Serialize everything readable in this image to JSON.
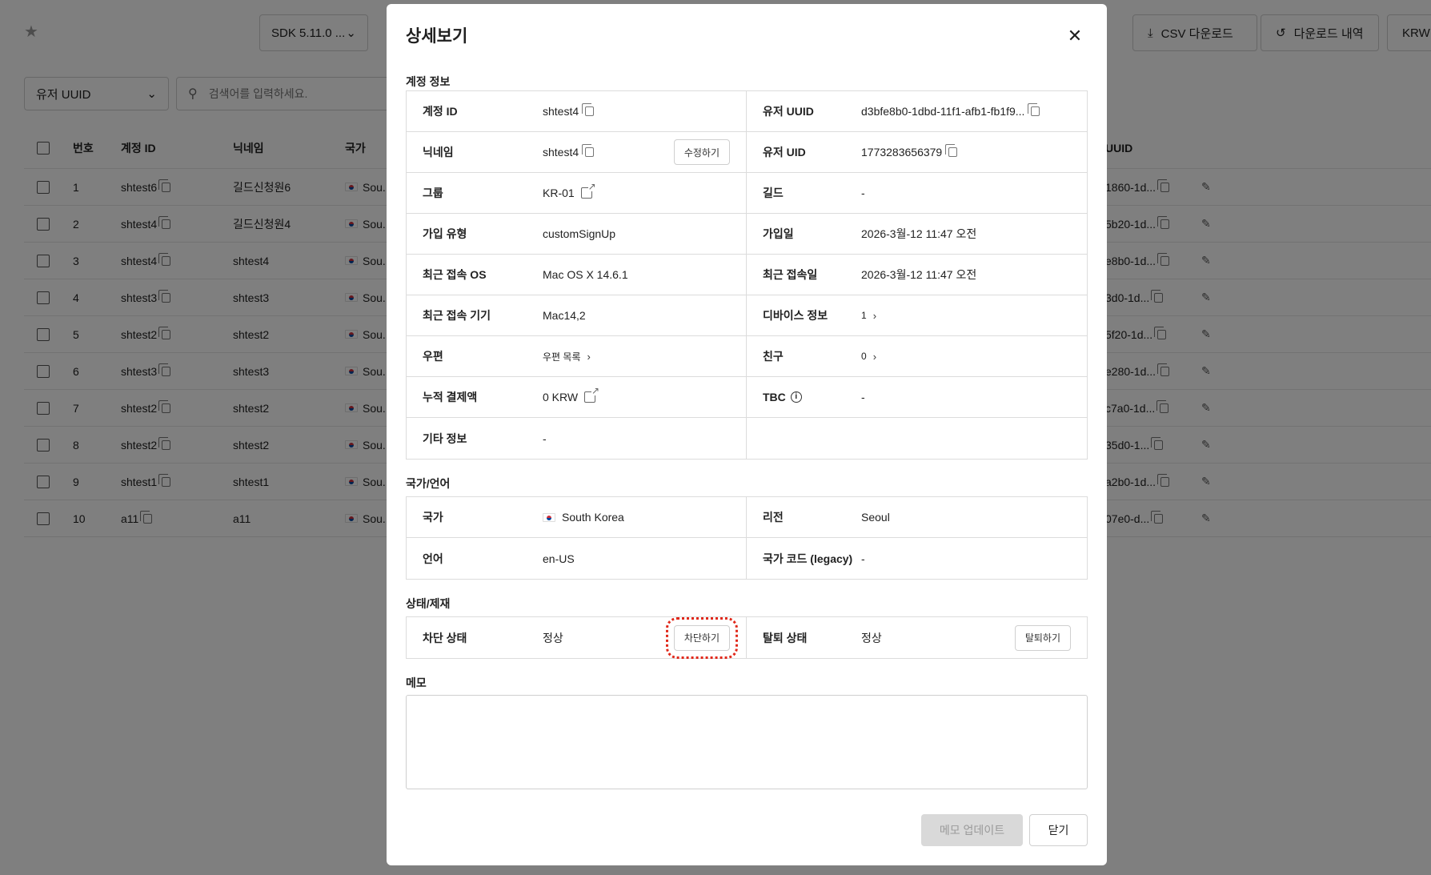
{
  "background": {
    "sdk_select": "SDK 5.11.0 ...",
    "top_buttons": [
      "CSV 다운로드",
      "다운로드 내역",
      "KRW ("
    ],
    "filter_select": "유저 UUID",
    "search_placeholder": "검색어를 입력하세요.",
    "table": {
      "headers": [
        "번호",
        "계정 ID",
        "닉네임",
        "국가",
        "UUID"
      ],
      "rows": [
        {
          "num": "1",
          "account": "shtest6",
          "nickname": "길드신청원6",
          "country": "Sou.",
          "uuid": "1860-1d..."
        },
        {
          "num": "2",
          "account": "shtest4",
          "nickname": "길드신청원4",
          "country": "Sou.",
          "uuid": "5b20-1d..."
        },
        {
          "num": "3",
          "account": "shtest4",
          "nickname": "shtest4",
          "country": "Sou.",
          "uuid": "e8b0-1d..."
        },
        {
          "num": "4",
          "account": "shtest3",
          "nickname": "shtest3",
          "country": "Sou.",
          "uuid": "3d0-1d..."
        },
        {
          "num": "5",
          "account": "shtest2",
          "nickname": "shtest2",
          "country": "Sou.",
          "uuid": "5f20-1d..."
        },
        {
          "num": "6",
          "account": "shtest3",
          "nickname": "shtest3",
          "country": "Sou.",
          "uuid": "e280-1d..."
        },
        {
          "num": "7",
          "account": "shtest2",
          "nickname": "shtest2",
          "country": "Sou.",
          "uuid": "c7a0-1d..."
        },
        {
          "num": "8",
          "account": "shtest2",
          "nickname": "shtest2",
          "country": "Sou.",
          "uuid": "35d0-1..."
        },
        {
          "num": "9",
          "account": "shtest1",
          "nickname": "shtest1",
          "country": "Sou.",
          "uuid": "a2b0-1d..."
        },
        {
          "num": "10",
          "account": "a11",
          "nickname": "a11",
          "country": "Sou.",
          "uuid": "07e0-d..."
        }
      ]
    }
  },
  "modal": {
    "title": "상세보기",
    "account_section": {
      "title": "계정 정보",
      "rows": [
        {
          "l_label": "계정 ID",
          "l_value": "shtest4",
          "r_label": "유저 UUID",
          "r_value": "d3bfe8b0-1dbd-11f1-afb1-fb1f9..."
        },
        {
          "l_label": "닉네임",
          "l_value": "shtest4",
          "l_button": "수정하기",
          "r_label": "유저 UID",
          "r_value": "1773283656379"
        },
        {
          "l_label": "그룹",
          "l_value": "KR-01",
          "r_label": "길드",
          "r_value": "-"
        },
        {
          "l_label": "가입 유형",
          "l_value": "customSignUp",
          "r_label": "가입일",
          "r_value": "2026-3월-12 11:47 오전"
        },
        {
          "l_label": "최근 접속 OS",
          "l_value": "Mac OS X 14.6.1",
          "r_label": "최근 접속일",
          "r_value": "2026-3월-12 11:47 오전"
        },
        {
          "l_label": "최근 접속 기기",
          "l_value": "Mac14,2",
          "r_label": "디바이스 정보",
          "r_value": "1"
        },
        {
          "l_label": "우편",
          "l_value": "우편 목록",
          "r_label": "친구",
          "r_value": "0"
        },
        {
          "l_label": "누적 결제액",
          "l_value": "0 KRW",
          "r_label": "TBC",
          "r_value": "-"
        },
        {
          "l_label": "기타 정보",
          "l_value": "-",
          "r_label": "",
          "r_value": ""
        }
      ]
    },
    "country_section": {
      "title": "국가/언어",
      "rows": [
        {
          "l_label": "국가",
          "l_value": "South Korea",
          "r_label": "리전",
          "r_value": "Seoul"
        },
        {
          "l_label": "언어",
          "l_value": "en-US",
          "r_label": "국가 코드 (legacy)",
          "r_value": "-"
        }
      ]
    },
    "status_section": {
      "title": "상태/제재",
      "block_label": "차단 상태",
      "block_value": "정상",
      "block_button": "차단하기",
      "withdraw_label": "탈퇴 상태",
      "withdraw_value": "정상",
      "withdraw_button": "탈퇴하기"
    },
    "memo": {
      "title": "메모",
      "value": ""
    },
    "footer": {
      "update_button": "메모 업데이트",
      "close_button": "닫기"
    }
  }
}
